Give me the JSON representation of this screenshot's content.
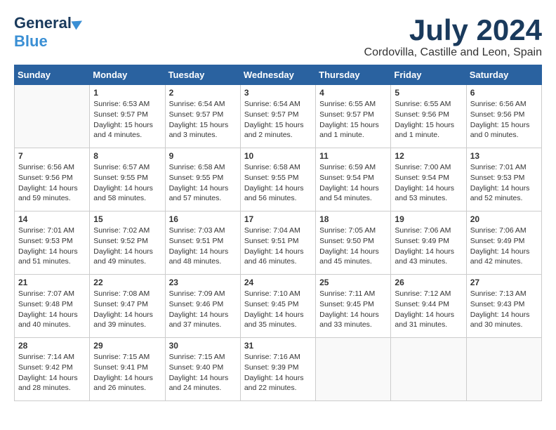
{
  "header": {
    "logo_general": "General",
    "logo_blue": "Blue",
    "month_title": "July 2024",
    "location": "Cordovilla, Castille and Leon, Spain"
  },
  "weekdays": [
    "Sunday",
    "Monday",
    "Tuesday",
    "Wednesday",
    "Thursday",
    "Friday",
    "Saturday"
  ],
  "weeks": [
    [
      {
        "day": "",
        "sunrise": "",
        "sunset": "",
        "daylight": ""
      },
      {
        "day": "1",
        "sunrise": "Sunrise: 6:53 AM",
        "sunset": "Sunset: 9:57 PM",
        "daylight": "Daylight: 15 hours and 4 minutes."
      },
      {
        "day": "2",
        "sunrise": "Sunrise: 6:54 AM",
        "sunset": "Sunset: 9:57 PM",
        "daylight": "Daylight: 15 hours and 3 minutes."
      },
      {
        "day": "3",
        "sunrise": "Sunrise: 6:54 AM",
        "sunset": "Sunset: 9:57 PM",
        "daylight": "Daylight: 15 hours and 2 minutes."
      },
      {
        "day": "4",
        "sunrise": "Sunrise: 6:55 AM",
        "sunset": "Sunset: 9:57 PM",
        "daylight": "Daylight: 15 hours and 1 minute."
      },
      {
        "day": "5",
        "sunrise": "Sunrise: 6:55 AM",
        "sunset": "Sunset: 9:56 PM",
        "daylight": "Daylight: 15 hours and 1 minute."
      },
      {
        "day": "6",
        "sunrise": "Sunrise: 6:56 AM",
        "sunset": "Sunset: 9:56 PM",
        "daylight": "Daylight: 15 hours and 0 minutes."
      }
    ],
    [
      {
        "day": "7",
        "sunrise": "Sunrise: 6:56 AM",
        "sunset": "Sunset: 9:56 PM",
        "daylight": "Daylight: 14 hours and 59 minutes."
      },
      {
        "day": "8",
        "sunrise": "Sunrise: 6:57 AM",
        "sunset": "Sunset: 9:55 PM",
        "daylight": "Daylight: 14 hours and 58 minutes."
      },
      {
        "day": "9",
        "sunrise": "Sunrise: 6:58 AM",
        "sunset": "Sunset: 9:55 PM",
        "daylight": "Daylight: 14 hours and 57 minutes."
      },
      {
        "day": "10",
        "sunrise": "Sunrise: 6:58 AM",
        "sunset": "Sunset: 9:55 PM",
        "daylight": "Daylight: 14 hours and 56 minutes."
      },
      {
        "day": "11",
        "sunrise": "Sunrise: 6:59 AM",
        "sunset": "Sunset: 9:54 PM",
        "daylight": "Daylight: 14 hours and 54 minutes."
      },
      {
        "day": "12",
        "sunrise": "Sunrise: 7:00 AM",
        "sunset": "Sunset: 9:54 PM",
        "daylight": "Daylight: 14 hours and 53 minutes."
      },
      {
        "day": "13",
        "sunrise": "Sunrise: 7:01 AM",
        "sunset": "Sunset: 9:53 PM",
        "daylight": "Daylight: 14 hours and 52 minutes."
      }
    ],
    [
      {
        "day": "14",
        "sunrise": "Sunrise: 7:01 AM",
        "sunset": "Sunset: 9:53 PM",
        "daylight": "Daylight: 14 hours and 51 minutes."
      },
      {
        "day": "15",
        "sunrise": "Sunrise: 7:02 AM",
        "sunset": "Sunset: 9:52 PM",
        "daylight": "Daylight: 14 hours and 49 minutes."
      },
      {
        "day": "16",
        "sunrise": "Sunrise: 7:03 AM",
        "sunset": "Sunset: 9:51 PM",
        "daylight": "Daylight: 14 hours and 48 minutes."
      },
      {
        "day": "17",
        "sunrise": "Sunrise: 7:04 AM",
        "sunset": "Sunset: 9:51 PM",
        "daylight": "Daylight: 14 hours and 46 minutes."
      },
      {
        "day": "18",
        "sunrise": "Sunrise: 7:05 AM",
        "sunset": "Sunset: 9:50 PM",
        "daylight": "Daylight: 14 hours and 45 minutes."
      },
      {
        "day": "19",
        "sunrise": "Sunrise: 7:06 AM",
        "sunset": "Sunset: 9:49 PM",
        "daylight": "Daylight: 14 hours and 43 minutes."
      },
      {
        "day": "20",
        "sunrise": "Sunrise: 7:06 AM",
        "sunset": "Sunset: 9:49 PM",
        "daylight": "Daylight: 14 hours and 42 minutes."
      }
    ],
    [
      {
        "day": "21",
        "sunrise": "Sunrise: 7:07 AM",
        "sunset": "Sunset: 9:48 PM",
        "daylight": "Daylight: 14 hours and 40 minutes."
      },
      {
        "day": "22",
        "sunrise": "Sunrise: 7:08 AM",
        "sunset": "Sunset: 9:47 PM",
        "daylight": "Daylight: 14 hours and 39 minutes."
      },
      {
        "day": "23",
        "sunrise": "Sunrise: 7:09 AM",
        "sunset": "Sunset: 9:46 PM",
        "daylight": "Daylight: 14 hours and 37 minutes."
      },
      {
        "day": "24",
        "sunrise": "Sunrise: 7:10 AM",
        "sunset": "Sunset: 9:45 PM",
        "daylight": "Daylight: 14 hours and 35 minutes."
      },
      {
        "day": "25",
        "sunrise": "Sunrise: 7:11 AM",
        "sunset": "Sunset: 9:45 PM",
        "daylight": "Daylight: 14 hours and 33 minutes."
      },
      {
        "day": "26",
        "sunrise": "Sunrise: 7:12 AM",
        "sunset": "Sunset: 9:44 PM",
        "daylight": "Daylight: 14 hours and 31 minutes."
      },
      {
        "day": "27",
        "sunrise": "Sunrise: 7:13 AM",
        "sunset": "Sunset: 9:43 PM",
        "daylight": "Daylight: 14 hours and 30 minutes."
      }
    ],
    [
      {
        "day": "28",
        "sunrise": "Sunrise: 7:14 AM",
        "sunset": "Sunset: 9:42 PM",
        "daylight": "Daylight: 14 hours and 28 minutes."
      },
      {
        "day": "29",
        "sunrise": "Sunrise: 7:15 AM",
        "sunset": "Sunset: 9:41 PM",
        "daylight": "Daylight: 14 hours and 26 minutes."
      },
      {
        "day": "30",
        "sunrise": "Sunrise: 7:15 AM",
        "sunset": "Sunset: 9:40 PM",
        "daylight": "Daylight: 14 hours and 24 minutes."
      },
      {
        "day": "31",
        "sunrise": "Sunrise: 7:16 AM",
        "sunset": "Sunset: 9:39 PM",
        "daylight": "Daylight: 14 hours and 22 minutes."
      },
      {
        "day": "",
        "sunrise": "",
        "sunset": "",
        "daylight": ""
      },
      {
        "day": "",
        "sunrise": "",
        "sunset": "",
        "daylight": ""
      },
      {
        "day": "",
        "sunrise": "",
        "sunset": "",
        "daylight": ""
      }
    ]
  ]
}
